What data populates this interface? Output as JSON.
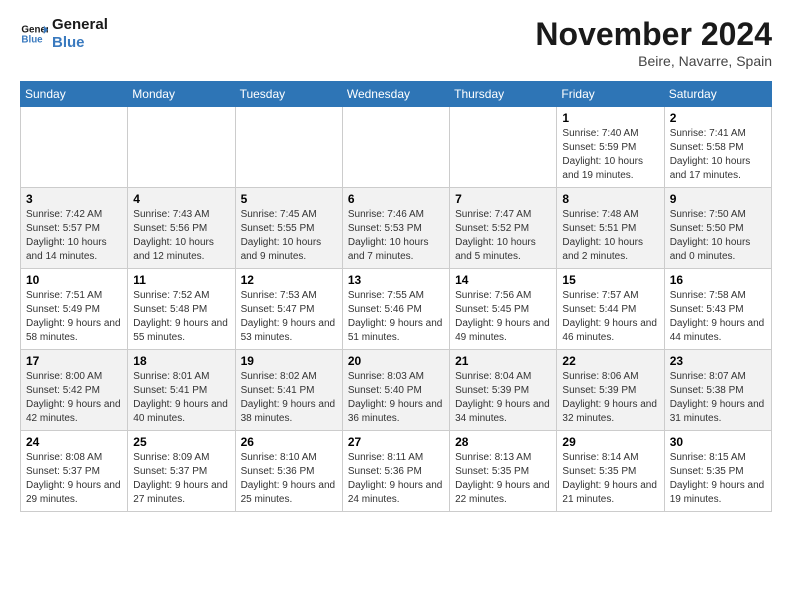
{
  "header": {
    "logo_line1": "General",
    "logo_line2": "Blue",
    "month": "November 2024",
    "location": "Beire, Navarre, Spain"
  },
  "weekdays": [
    "Sunday",
    "Monday",
    "Tuesday",
    "Wednesday",
    "Thursday",
    "Friday",
    "Saturday"
  ],
  "weeks": [
    [
      {
        "day": "",
        "info": ""
      },
      {
        "day": "",
        "info": ""
      },
      {
        "day": "",
        "info": ""
      },
      {
        "day": "",
        "info": ""
      },
      {
        "day": "",
        "info": ""
      },
      {
        "day": "1",
        "info": "Sunrise: 7:40 AM\nSunset: 5:59 PM\nDaylight: 10 hours and 19 minutes."
      },
      {
        "day": "2",
        "info": "Sunrise: 7:41 AM\nSunset: 5:58 PM\nDaylight: 10 hours and 17 minutes."
      }
    ],
    [
      {
        "day": "3",
        "info": "Sunrise: 7:42 AM\nSunset: 5:57 PM\nDaylight: 10 hours and 14 minutes."
      },
      {
        "day": "4",
        "info": "Sunrise: 7:43 AM\nSunset: 5:56 PM\nDaylight: 10 hours and 12 minutes."
      },
      {
        "day": "5",
        "info": "Sunrise: 7:45 AM\nSunset: 5:55 PM\nDaylight: 10 hours and 9 minutes."
      },
      {
        "day": "6",
        "info": "Sunrise: 7:46 AM\nSunset: 5:53 PM\nDaylight: 10 hours and 7 minutes."
      },
      {
        "day": "7",
        "info": "Sunrise: 7:47 AM\nSunset: 5:52 PM\nDaylight: 10 hours and 5 minutes."
      },
      {
        "day": "8",
        "info": "Sunrise: 7:48 AM\nSunset: 5:51 PM\nDaylight: 10 hours and 2 minutes."
      },
      {
        "day": "9",
        "info": "Sunrise: 7:50 AM\nSunset: 5:50 PM\nDaylight: 10 hours and 0 minutes."
      }
    ],
    [
      {
        "day": "10",
        "info": "Sunrise: 7:51 AM\nSunset: 5:49 PM\nDaylight: 9 hours and 58 minutes."
      },
      {
        "day": "11",
        "info": "Sunrise: 7:52 AM\nSunset: 5:48 PM\nDaylight: 9 hours and 55 minutes."
      },
      {
        "day": "12",
        "info": "Sunrise: 7:53 AM\nSunset: 5:47 PM\nDaylight: 9 hours and 53 minutes."
      },
      {
        "day": "13",
        "info": "Sunrise: 7:55 AM\nSunset: 5:46 PM\nDaylight: 9 hours and 51 minutes."
      },
      {
        "day": "14",
        "info": "Sunrise: 7:56 AM\nSunset: 5:45 PM\nDaylight: 9 hours and 49 minutes."
      },
      {
        "day": "15",
        "info": "Sunrise: 7:57 AM\nSunset: 5:44 PM\nDaylight: 9 hours and 46 minutes."
      },
      {
        "day": "16",
        "info": "Sunrise: 7:58 AM\nSunset: 5:43 PM\nDaylight: 9 hours and 44 minutes."
      }
    ],
    [
      {
        "day": "17",
        "info": "Sunrise: 8:00 AM\nSunset: 5:42 PM\nDaylight: 9 hours and 42 minutes."
      },
      {
        "day": "18",
        "info": "Sunrise: 8:01 AM\nSunset: 5:41 PM\nDaylight: 9 hours and 40 minutes."
      },
      {
        "day": "19",
        "info": "Sunrise: 8:02 AM\nSunset: 5:41 PM\nDaylight: 9 hours and 38 minutes."
      },
      {
        "day": "20",
        "info": "Sunrise: 8:03 AM\nSunset: 5:40 PM\nDaylight: 9 hours and 36 minutes."
      },
      {
        "day": "21",
        "info": "Sunrise: 8:04 AM\nSunset: 5:39 PM\nDaylight: 9 hours and 34 minutes."
      },
      {
        "day": "22",
        "info": "Sunrise: 8:06 AM\nSunset: 5:39 PM\nDaylight: 9 hours and 32 minutes."
      },
      {
        "day": "23",
        "info": "Sunrise: 8:07 AM\nSunset: 5:38 PM\nDaylight: 9 hours and 31 minutes."
      }
    ],
    [
      {
        "day": "24",
        "info": "Sunrise: 8:08 AM\nSunset: 5:37 PM\nDaylight: 9 hours and 29 minutes."
      },
      {
        "day": "25",
        "info": "Sunrise: 8:09 AM\nSunset: 5:37 PM\nDaylight: 9 hours and 27 minutes."
      },
      {
        "day": "26",
        "info": "Sunrise: 8:10 AM\nSunset: 5:36 PM\nDaylight: 9 hours and 25 minutes."
      },
      {
        "day": "27",
        "info": "Sunrise: 8:11 AM\nSunset: 5:36 PM\nDaylight: 9 hours and 24 minutes."
      },
      {
        "day": "28",
        "info": "Sunrise: 8:13 AM\nSunset: 5:35 PM\nDaylight: 9 hours and 22 minutes."
      },
      {
        "day": "29",
        "info": "Sunrise: 8:14 AM\nSunset: 5:35 PM\nDaylight: 9 hours and 21 minutes."
      },
      {
        "day": "30",
        "info": "Sunrise: 8:15 AM\nSunset: 5:35 PM\nDaylight: 9 hours and 19 minutes."
      }
    ]
  ]
}
